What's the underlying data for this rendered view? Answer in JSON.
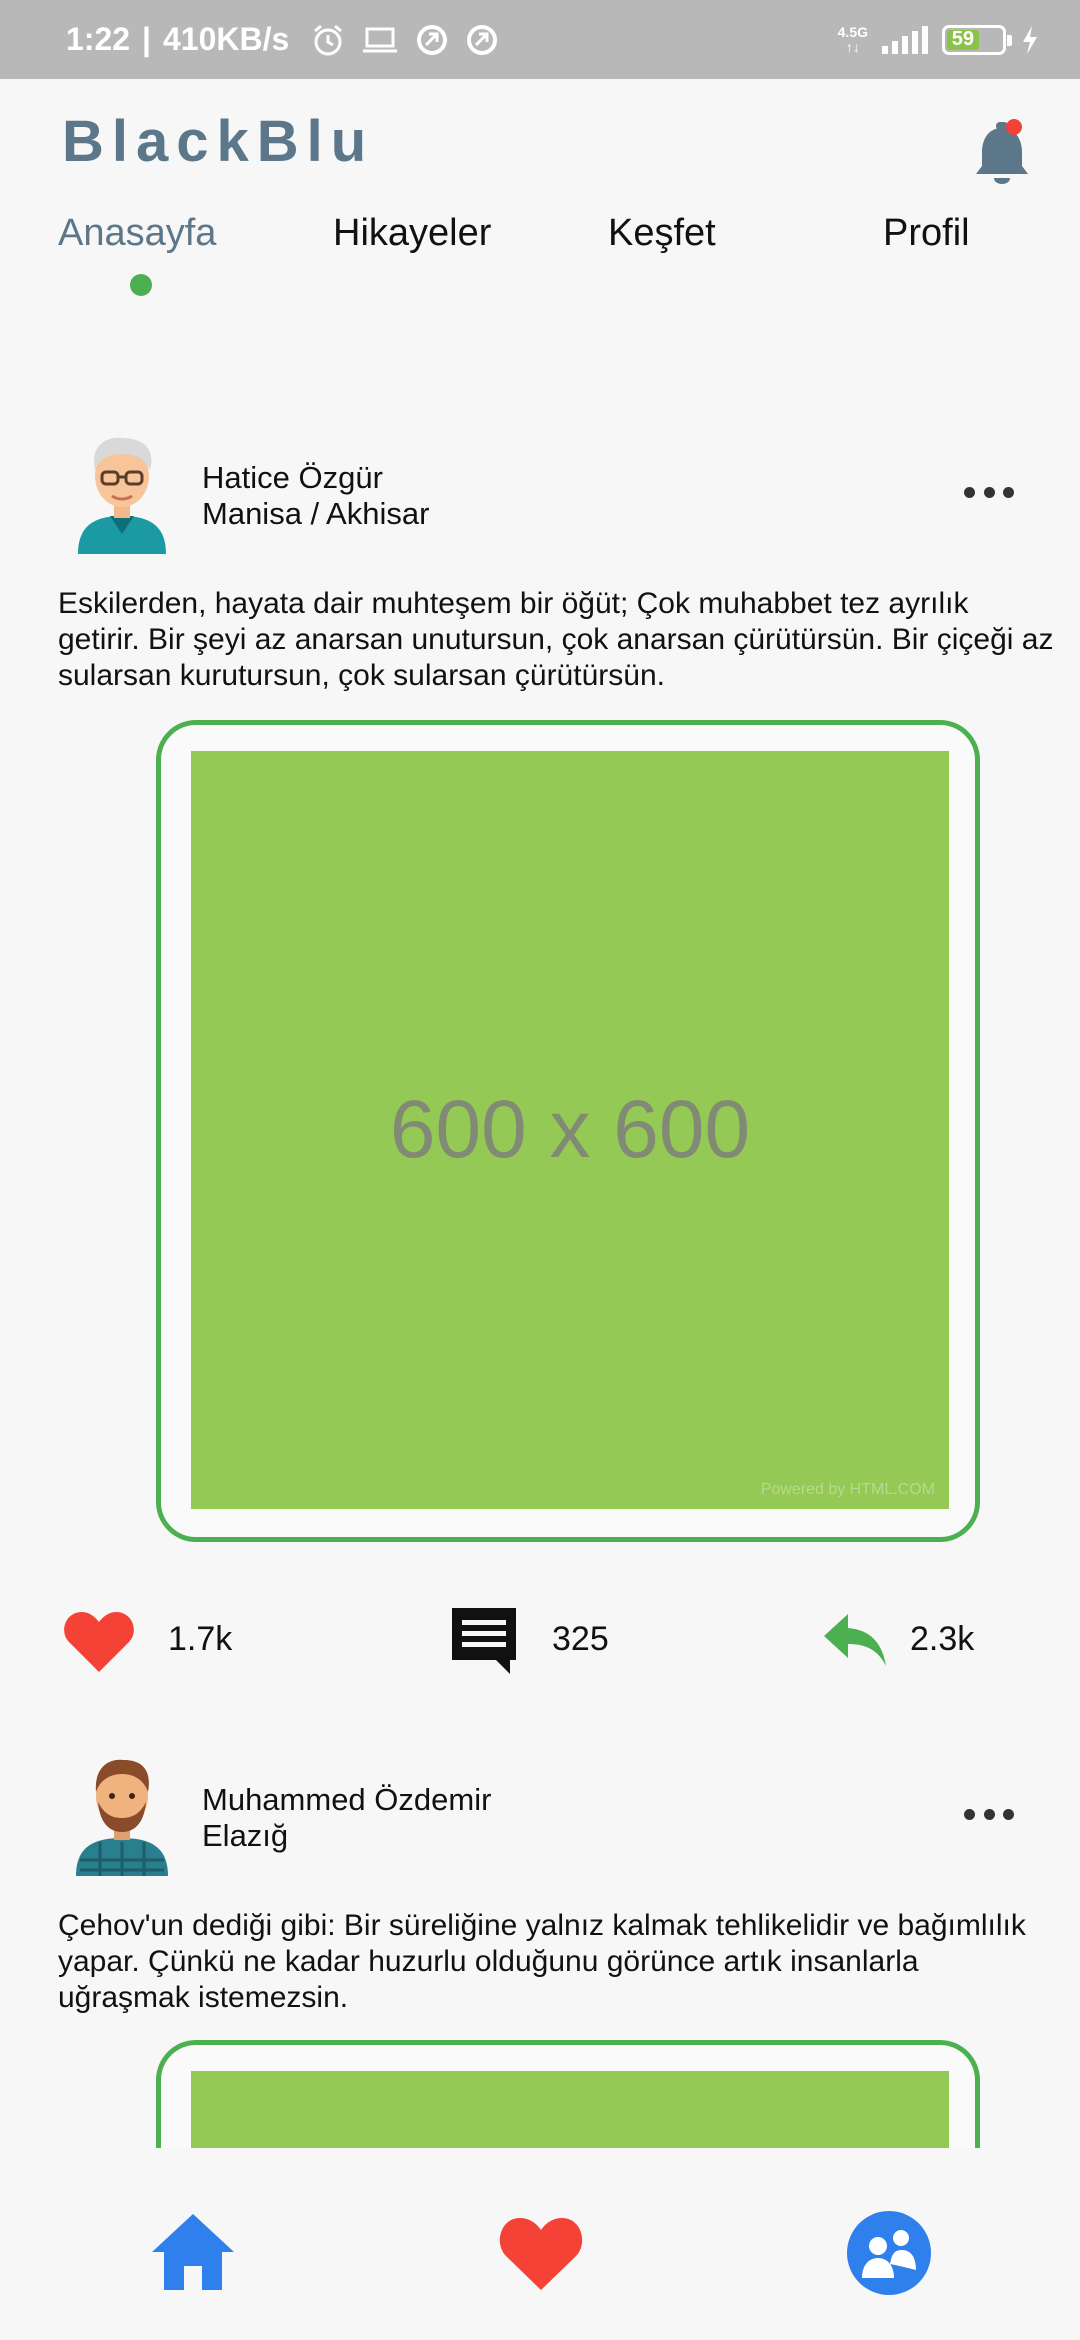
{
  "status_bar": {
    "time": "1:22",
    "separator": "|",
    "speed": "410KB/s",
    "network_type": "4.5G",
    "battery_level": "59",
    "icons": [
      "alarm-icon",
      "laptop-icon",
      "sync-icon",
      "sync-icon",
      "signal-icon",
      "battery-icon",
      "charging-icon"
    ]
  },
  "header": {
    "title": "BlackBlu",
    "notification_icon": "bell-icon"
  },
  "tabs": [
    {
      "label": "Anasayfa",
      "active": true
    },
    {
      "label": "Hikayeler",
      "active": false
    },
    {
      "label": "Keşfet",
      "active": false
    },
    {
      "label": "Profil",
      "active": false
    }
  ],
  "posts": [
    {
      "name": "Hatice Özgür",
      "location": "Manisa / Akhisar",
      "text": "Eskilerden, hayata dair muhteşem bir öğüt; Çok muhabbet tez ayrılık getirir. Bir şeyi az anarsan unutursun, çok anarsan çürütürsün. Bir çiçeği az sularsan kurutursun, çok sularsan çürütürsün.",
      "image_label": "600 x 600",
      "image_credit": "Powered by HTML.COM",
      "likes": "1.7k",
      "comments": "325",
      "shares": "2.3k"
    },
    {
      "name": "Muhammed Özdemir",
      "location": "Elazığ",
      "text": "Çehov'un dediği gibi: Bir süreliğine yalnız kalmak tehlikelidir ve bağımlılık yapar. Çünkü ne kadar huzurlu olduğunu görünce artık insanlarla uğraşmak istemezsin."
    }
  ],
  "bottom_nav": [
    "home-icon",
    "heart-icon",
    "people-icon"
  ],
  "colors": {
    "accent_green": "#4caf50",
    "title_blue_gray": "#5b7789",
    "like_red": "#f44336",
    "nav_blue": "#2f80ed",
    "placeholder_green": "#93c954"
  }
}
